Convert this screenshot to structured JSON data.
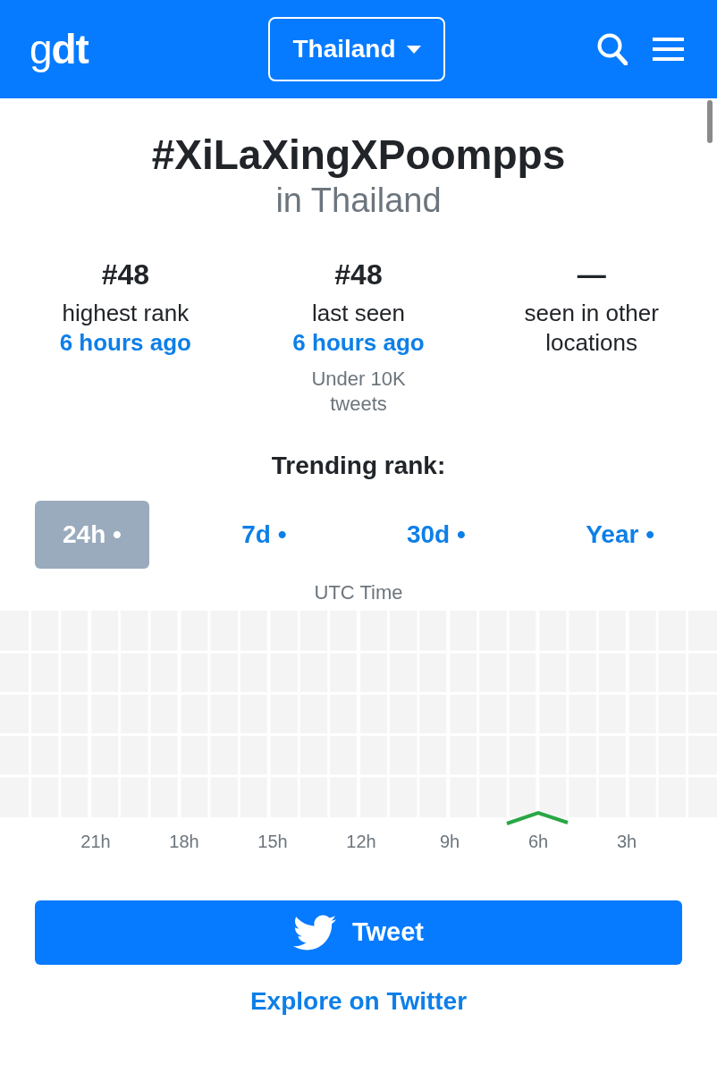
{
  "header": {
    "logo": "g**dt**",
    "country_selector": {
      "label": "Thailand"
    }
  },
  "title": "#XiLaXingXPoompps",
  "subtitle": "in Thailand",
  "stats": [
    {
      "value": "#48",
      "label": "highest rank",
      "time": "6 hours ago"
    },
    {
      "value": "#48",
      "label": "last seen",
      "time": "6 hours ago",
      "note": "Under 10K tweets"
    },
    {
      "value": "—",
      "label": "seen in other locations"
    }
  ],
  "trending": {
    "heading": "Trending rank:",
    "tabs": [
      {
        "label": "24h •",
        "selected": true
      },
      {
        "label": "7d •",
        "selected": false
      },
      {
        "label": "30d •",
        "selected": false
      },
      {
        "label": "Year •",
        "selected": false
      }
    ],
    "axis_title": "UTC Time",
    "time_labels": [
      "21h",
      "18h",
      "15h",
      "12h",
      "9h",
      "6h",
      "3h"
    ]
  },
  "actions": {
    "tweet_button": "Tweet",
    "explore_link": "Explore on Twitter"
  }
}
